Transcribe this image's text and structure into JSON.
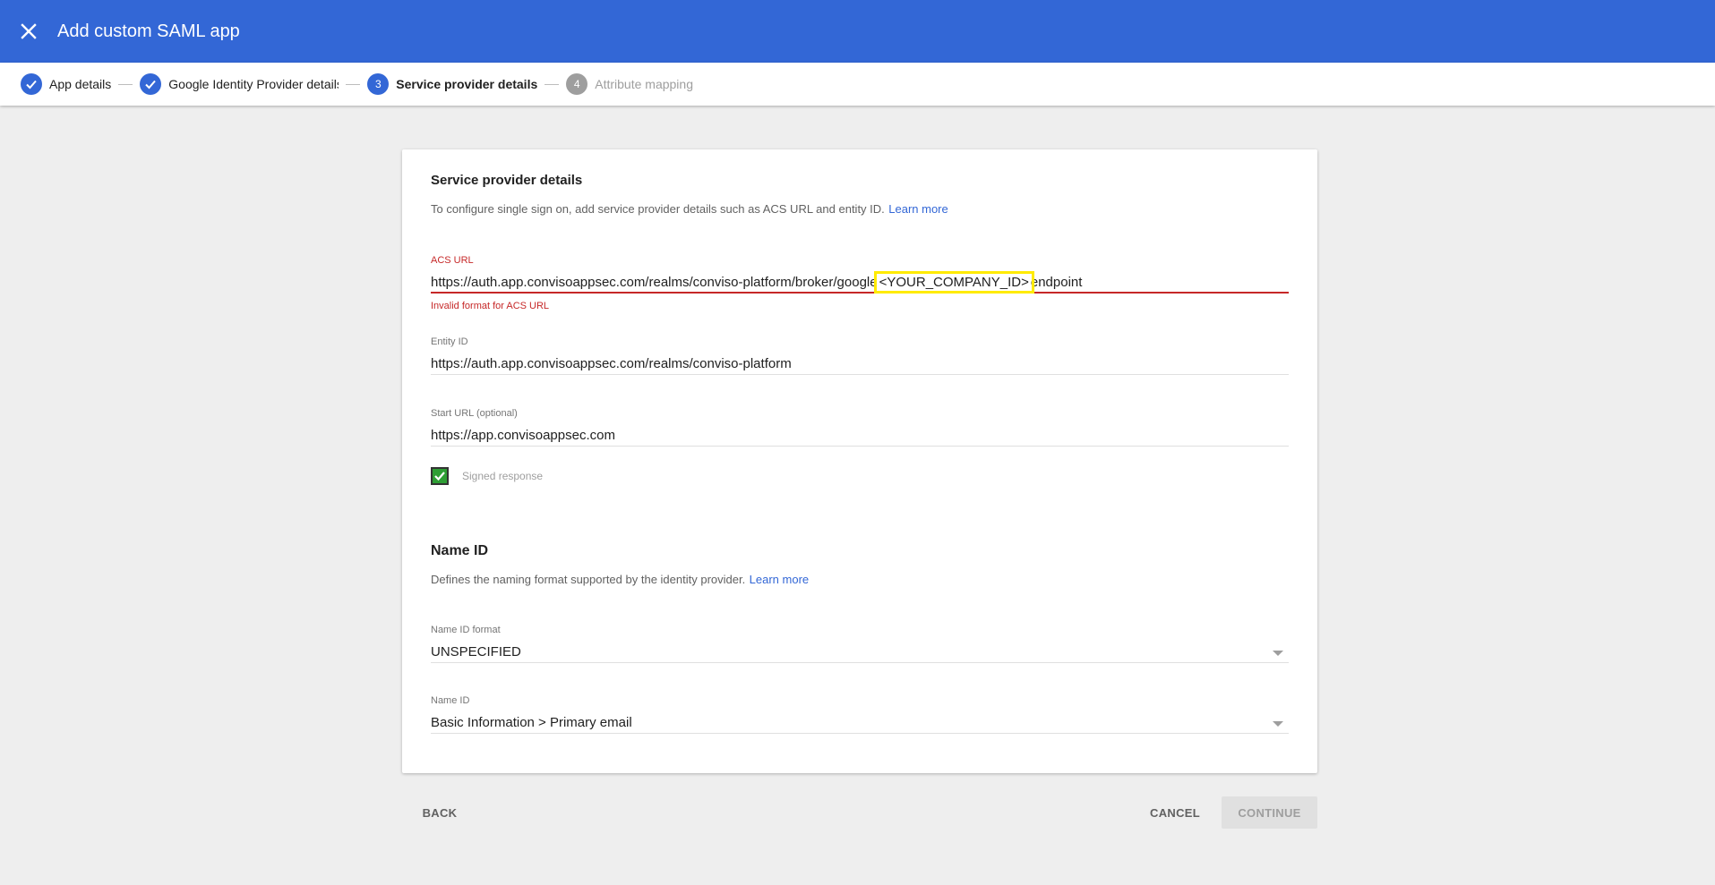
{
  "header": {
    "title": "Add custom SAML app",
    "close_icon": "close-icon"
  },
  "stepper": {
    "steps": [
      {
        "number": "1",
        "label": "App details",
        "state": "done"
      },
      {
        "number": "2",
        "label": "Google Identity Provider details",
        "state": "done"
      },
      {
        "number": "3",
        "label": "Service provider details",
        "state": "active"
      },
      {
        "number": "4",
        "label": "Attribute mapping",
        "state": "future"
      }
    ]
  },
  "service_provider": {
    "title": "Service provider details",
    "description": "To configure single sign on, add service provider details such as ACS URL and entity ID.",
    "learn_more": "Learn more",
    "acs_url": {
      "label": "ACS URL",
      "value_prefix": "https://auth.app.convisoappsec.com/realms/conviso-platform/broker/google",
      "value_highlight": "<YOUR_COMPANY_ID>",
      "value_suffix": "endpoint",
      "error": "Invalid format for ACS URL"
    },
    "entity_id": {
      "label": "Entity ID",
      "value": "https://auth.app.convisoappsec.com/realms/conviso-platform"
    },
    "start_url": {
      "label": "Start URL (optional)",
      "value": "https://app.convisoappsec.com"
    },
    "signed_response": {
      "label": "Signed response",
      "checked": true
    }
  },
  "name_id": {
    "title": "Name ID",
    "description": "Defines the naming format supported by the identity provider.",
    "learn_more": "Learn more",
    "format": {
      "label": "Name ID format",
      "value": "UNSPECIFIED"
    },
    "name_id": {
      "label": "Name ID",
      "value": "Basic Information > Primary email"
    }
  },
  "footer": {
    "back": "BACK",
    "cancel": "CANCEL",
    "continue": "CONTINUE"
  }
}
